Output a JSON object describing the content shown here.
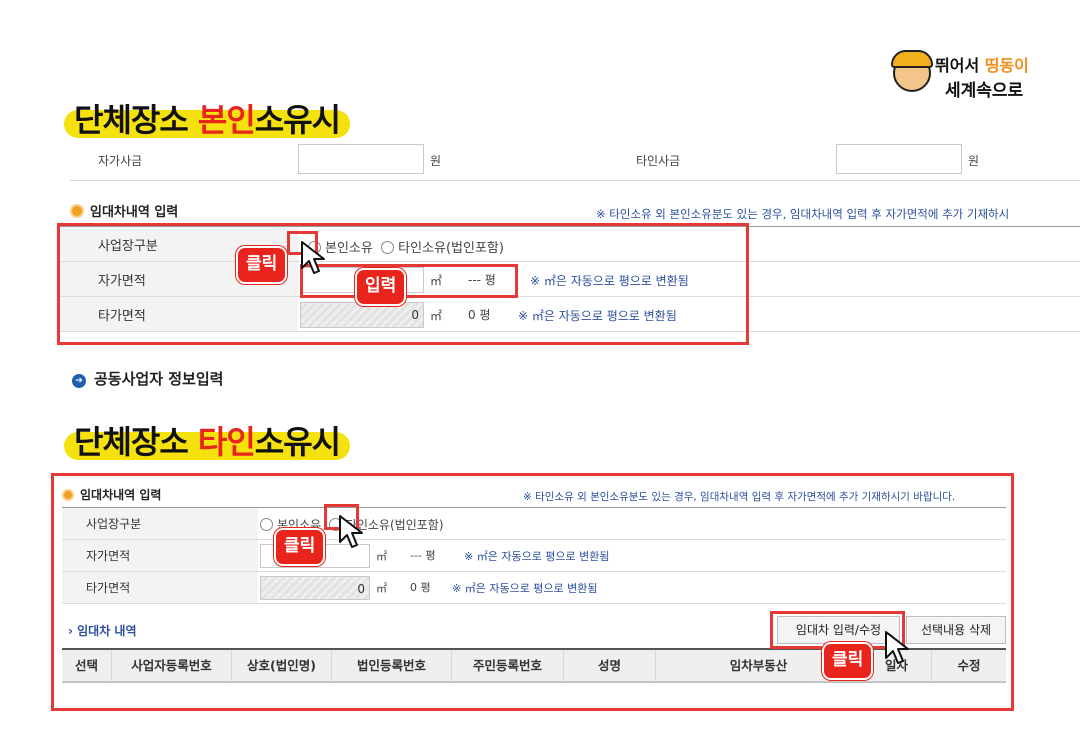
{
  "logo": {
    "line1_a": "뛰어서 ",
    "line1_b": "띵동이",
    "line2": "세계속으로"
  },
  "heading1": {
    "pre": "단체장소 ",
    "red": "본인",
    "post": "소유시"
  },
  "heading2": {
    "pre": "단체장소 ",
    "red": "타인",
    "post": "소유시"
  },
  "top_cutoff": {
    "left_label": "자가사금",
    "left_unit": "원",
    "right_label": "타인사금",
    "right_unit": "원"
  },
  "panel1": {
    "section_title": "임대차내역 입력",
    "notice": "※ 타인소유 외 본인소유분도 있는 경우, 임대차내역 입력 후 자가면적에 추가 기재하시",
    "rows": {
      "business_type": {
        "label": "사업장구분",
        "opt1": "본인소유",
        "opt2": "타인소유(법인포함)"
      },
      "own_area": {
        "label": "자가면적",
        "value": "",
        "unit_m2": "㎡",
        "pyeong": "--- 평",
        "hint": "※ ㎡은 자동으로 평으로 변환됨"
      },
      "other_area": {
        "label": "타가면적",
        "value": "0",
        "unit_m2": "㎡",
        "pyeong": "0 평",
        "hint": "※ ㎡은 자동으로 평으로 변환됨"
      }
    },
    "badge_click": "클릭",
    "badge_input": "입력"
  },
  "joint": {
    "title": "공동사업자 정보입력"
  },
  "panel2": {
    "section_title": "임대차내역 입력",
    "notice": "※ 타인소유 외 본인소유분도 있는 경우, 임대차내역 입력 후 자가면적에 추가 기재하시기 바랍니다.",
    "rows": {
      "business_type": {
        "label": "사업장구분",
        "opt1": "본인소유",
        "opt2": "타인소유(법인포함)"
      },
      "own_area": {
        "label": "자가면적",
        "value": "",
        "unit_m2": "㎡",
        "pyeong": "--- 평",
        "hint": "※ ㎡은 자동으로 평으로 변환됨"
      },
      "other_area": {
        "label": "타가면적",
        "value": "0",
        "unit_m2": "㎡",
        "pyeong": "0 평",
        "hint": "※ ㎡은 자동으로 평으로 변환됨"
      }
    },
    "lease_title": "› 임대차 내역",
    "btn_input": "임대차 입력/수정",
    "btn_delete": "선택내용 삭제",
    "badge_click1": "클릭",
    "badge_click2": "클릭",
    "columns": [
      "선택",
      "사업자등록번호",
      "상호(법인명)",
      "법인등록번호",
      "주민등록번호",
      "성명",
      "임차부동산",
      "일자",
      "수정"
    ]
  },
  "colors": {
    "highlight": "#f5e10e",
    "accent_red": "#e8241c",
    "box_red": "#e53935",
    "note_blue": "#2c4f9e"
  }
}
